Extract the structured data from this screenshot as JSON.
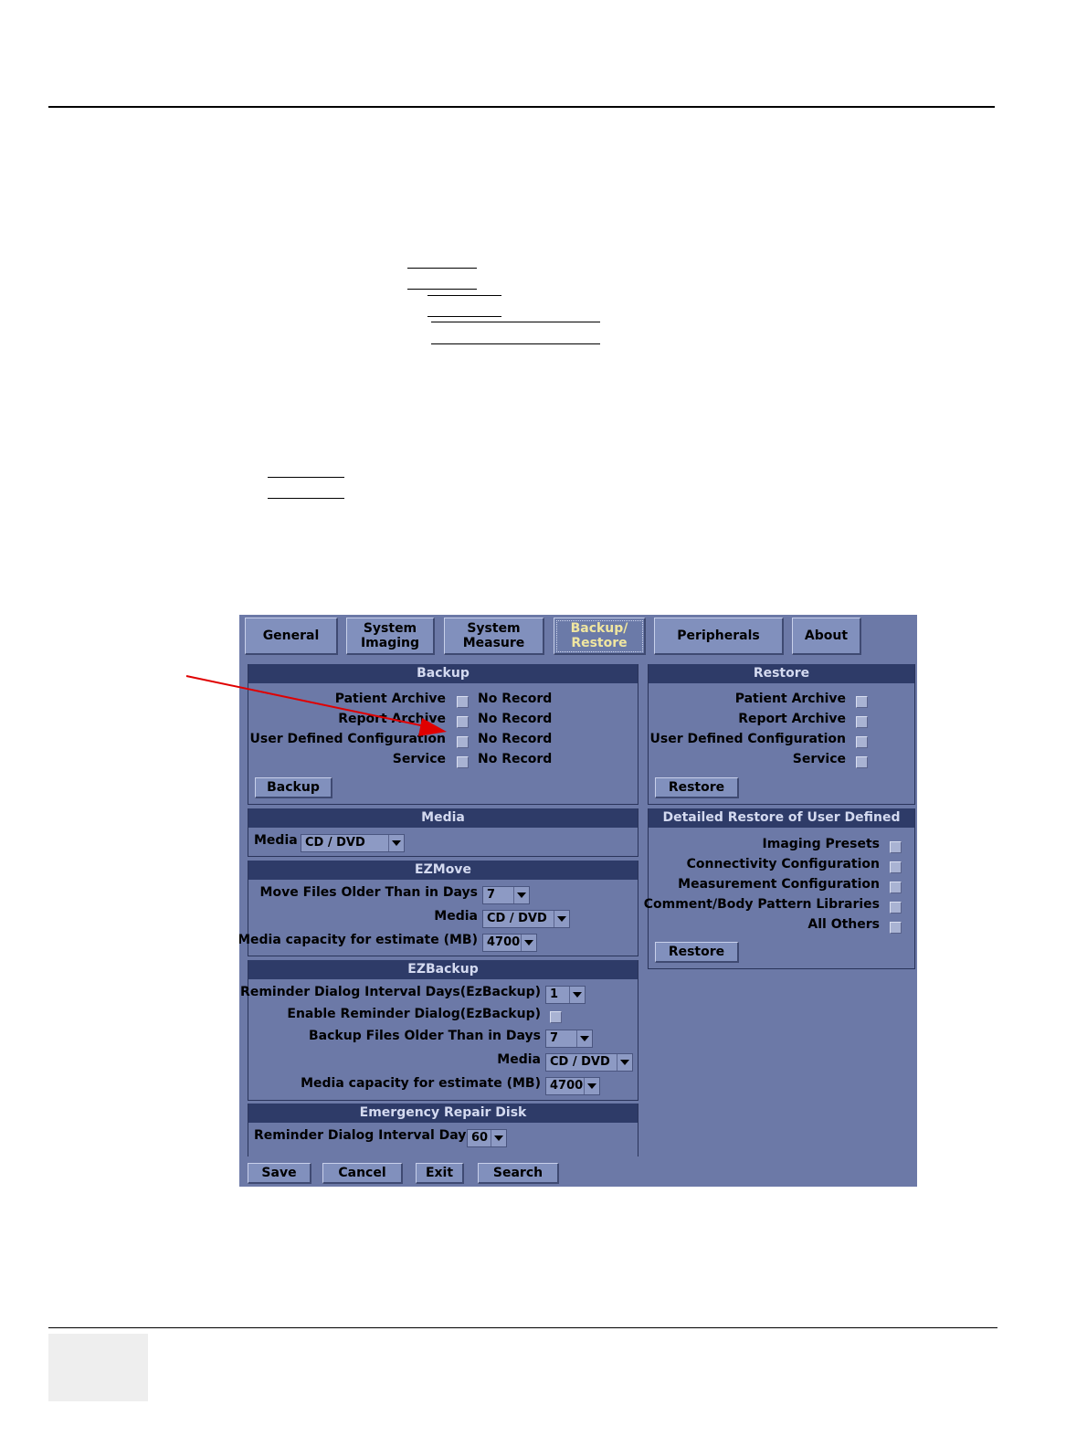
{
  "tabs": [
    {
      "label": "General"
    },
    {
      "label": "System\nImaging"
    },
    {
      "label": "System\nMeasure"
    },
    {
      "label": "Backup/\nRestore"
    },
    {
      "label": "Peripherals"
    },
    {
      "label": "About"
    }
  ],
  "backup": {
    "title": "Backup",
    "items": [
      {
        "label": "Patient Archive",
        "status": "No Record"
      },
      {
        "label": "Report Archive",
        "status": "No Record"
      },
      {
        "label": "User Defined Configuration",
        "status": "No Record"
      },
      {
        "label": "Service",
        "status": "No Record"
      }
    ],
    "button": "Backup"
  },
  "restore": {
    "title": "Restore",
    "items": [
      {
        "label": "Patient Archive"
      },
      {
        "label": "Report Archive"
      },
      {
        "label": "User Defined Configuration"
      },
      {
        "label": "Service"
      }
    ],
    "button": "Restore"
  },
  "media": {
    "title": "Media",
    "label": "Media",
    "value": "CD / DVD"
  },
  "ezmove": {
    "title": "EZMove",
    "rows": [
      {
        "label": "Move Files Older Than in Days",
        "value": "7"
      },
      {
        "label": "Media",
        "value": "CD / DVD"
      },
      {
        "label": "Media capacity for estimate (MB)",
        "value": "4700"
      }
    ]
  },
  "ezbackup": {
    "title": "EZBackup",
    "interval_label": "Reminder Dialog Interval Days(EzBackup)",
    "interval_value": "1",
    "enable_label": "Enable Reminder Dialog(EzBackup)",
    "older_label": "Backup Files Older Than in Days",
    "older_value": "7",
    "media_label": "Media",
    "media_value": "CD / DVD",
    "capacity_label": "Media capacity for estimate (MB)",
    "capacity_value": "4700"
  },
  "erd": {
    "title": "Emergency Repair Disk",
    "interval_label": "Reminder Dialog Interval Days",
    "interval_value": "60"
  },
  "detailed_restore": {
    "title": "Detailed Restore of User Defined",
    "items": [
      {
        "label": "Imaging Presets"
      },
      {
        "label": "Connectivity Configuration"
      },
      {
        "label": "Measurement Configuration"
      },
      {
        "label": "Comment/Body Pattern Libraries"
      },
      {
        "label": "All Others"
      }
    ],
    "button": "Restore"
  },
  "bottom_buttons": {
    "save": "Save",
    "cancel": "Cancel",
    "exit": "Exit",
    "search": "Search"
  },
  "colors": {
    "annotation_arrow": "#e00000",
    "ui_background": "#6c79a7",
    "panel_header": "#2e3b68",
    "active_tab_text": "#f0e6a0"
  }
}
